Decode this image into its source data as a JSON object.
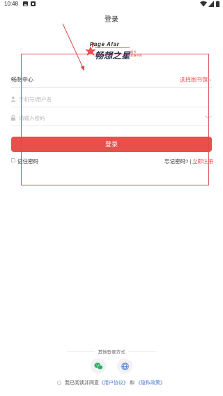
{
  "status_bar": {
    "time": "10:48"
  },
  "page": {
    "title": "登录"
  },
  "logo": {
    "text_en": "Page Afar",
    "text_cn": "畅想之星",
    "badge_line1": "随书",
    "badge_line2": "资源平台"
  },
  "library": {
    "center_label": "畅想中心",
    "select_label": "选择图书馆 ›"
  },
  "form": {
    "username_placeholder": "手机号/用户名",
    "password_placeholder": "请输入密码",
    "login_button": "登录",
    "remember_label": "记住密码",
    "forgot_label": "忘记密码?",
    "separator": "|",
    "register_label": "立即注册"
  },
  "other_login": {
    "label": "其他登录方式"
  },
  "agreement": {
    "prefix": "我已阅读并同意",
    "user_agreement": "《用户协议》",
    "and": "和",
    "privacy_policy": "《隐私政策》"
  },
  "colors": {
    "accent": "#e8504b",
    "link": "#4a7bd0",
    "annotation": "#e04a4a",
    "wechat": "#2aae67"
  },
  "icons": {
    "status": [
      "gallery-icon",
      "notification-icon",
      "wifi-icon",
      "signal-icon",
      "battery-icon"
    ],
    "fields": [
      "user-icon",
      "lock-icon",
      "eye-closed-icon"
    ],
    "other_login": [
      "wechat-icon",
      "web-icon"
    ]
  }
}
